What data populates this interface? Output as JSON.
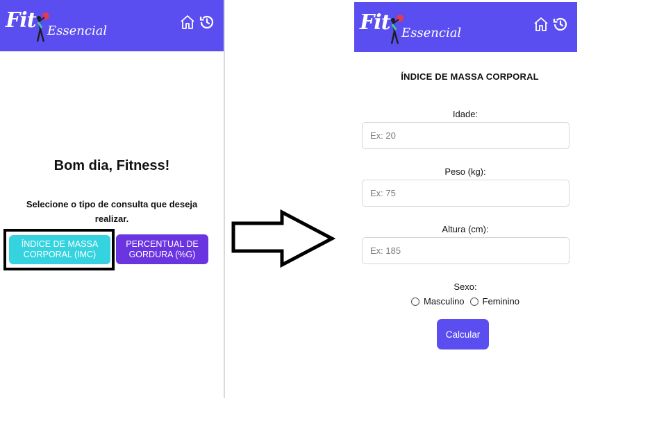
{
  "left_screen": {
    "logo": {
      "fit": "Fit",
      "essencial": "Essencial"
    },
    "greeting": "Bom dia, Fitness!",
    "subtitle": "Selecione o tipo de consulta que deseja realizar.",
    "buttons": {
      "imc": "ÍNDICE DE MASSA CORPORAL (IMC)",
      "gordura": "PERCENTUAL DE GORDURA (%G)"
    },
    "icons": [
      "home-icon",
      "history-icon"
    ]
  },
  "right_screen": {
    "logo": {
      "fit": "Fit",
      "essencial": "Essencial"
    },
    "title": "ÍNDICE DE MASSA CORPORAL",
    "fields": [
      {
        "label": "Idade:",
        "placeholder": "Ex: 20"
      },
      {
        "label": "Peso (kg):",
        "placeholder": "Ex: 75"
      },
      {
        "label": "Altura (cm):",
        "placeholder": "Ex: 185"
      }
    ],
    "sexo": {
      "label": "Sexo:",
      "options": [
        "Masculino",
        "Feminino"
      ]
    },
    "submit": "Calcular",
    "icons": [
      "home-icon",
      "history-icon"
    ]
  },
  "colors": {
    "appbar": "#5b4ef0",
    "imc_button": "#35d3df",
    "gordura_button": "#6a34e0",
    "calc_button": "#5b4ef0"
  }
}
